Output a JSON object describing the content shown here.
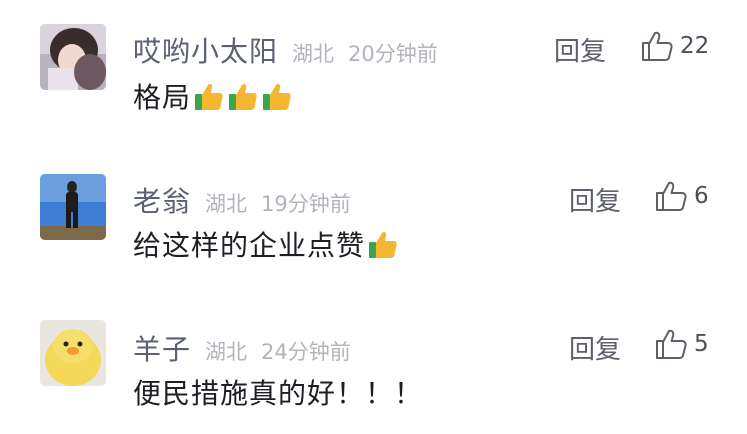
{
  "comments": [
    {
      "username": "哎哟小太阳",
      "location": "湖北",
      "time": "20分钟前",
      "text": "格局",
      "emojis": [
        "thumbs-up",
        "thumbs-up",
        "thumbs-up"
      ],
      "reply_label": "回复",
      "likes": "22"
    },
    {
      "username": "老翁",
      "location": "湖北",
      "time": "19分钟前",
      "text": "给这样的企业点赞",
      "emojis": [
        "thumbs-up"
      ],
      "reply_label": "回复",
      "likes": "6"
    },
    {
      "username": "羊子",
      "location": "湖北",
      "time": "24分钟前",
      "text": "便民措施真的好！！！",
      "emojis": [],
      "reply_label": "回复",
      "likes": "5"
    }
  ],
  "colors": {
    "username": "#5b6172",
    "meta": "#b2b4bb",
    "body_text": "#1e1f24",
    "action": "#5d606b",
    "emoji_hand": "#f5b731",
    "emoji_sleeve": "#3aa54a"
  }
}
